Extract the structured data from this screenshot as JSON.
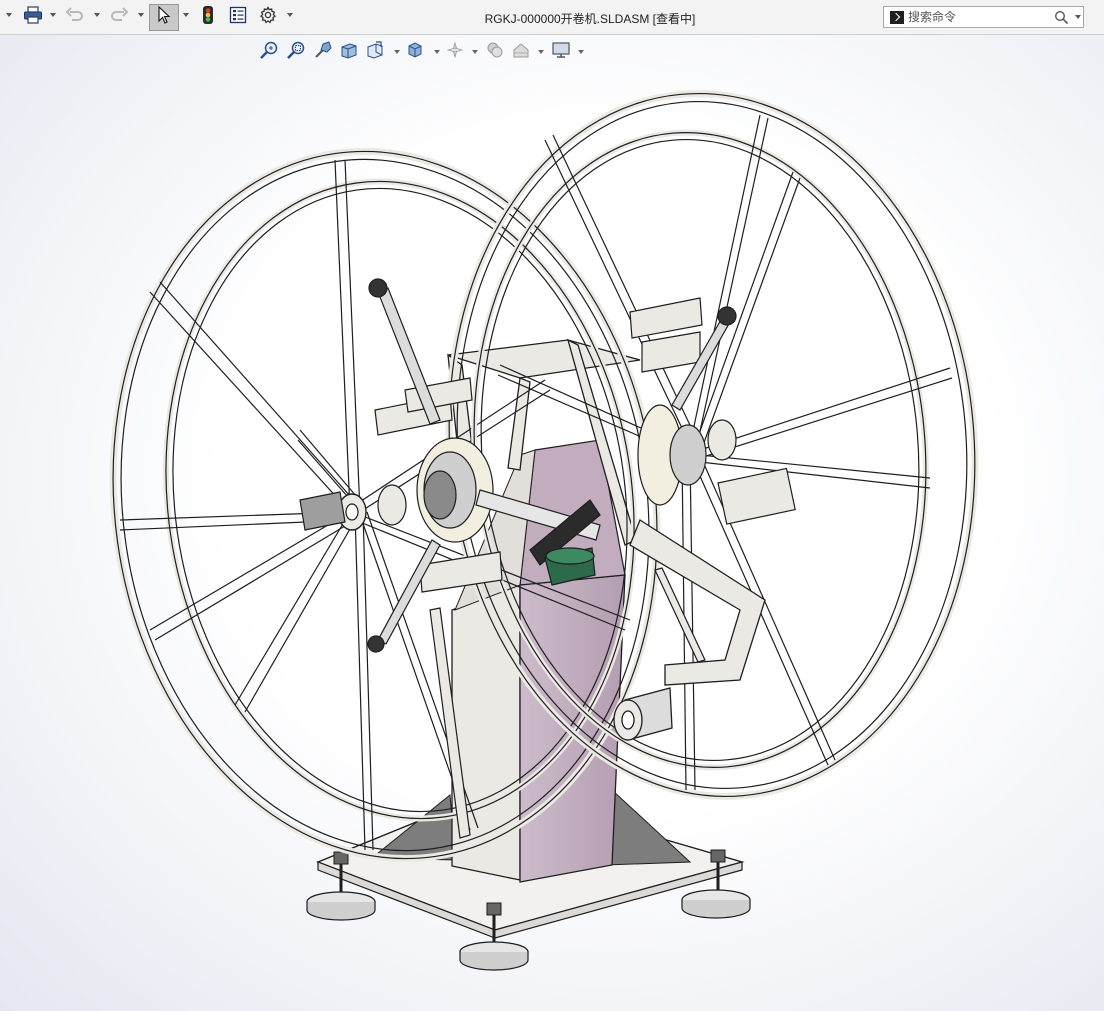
{
  "window": {
    "title": "RGKJ-000000开卷机.SLDASM [查看中]"
  },
  "toolbar": {
    "items": [
      {
        "name": "print",
        "icon": "printer-icon"
      },
      {
        "name": "undo",
        "icon": "undo-icon"
      },
      {
        "name": "redo",
        "icon": "redo-icon"
      },
      {
        "name": "select",
        "icon": "cursor-arrow-icon"
      },
      {
        "name": "rebuild",
        "icon": "traffic-light-icon"
      },
      {
        "name": "file-properties",
        "icon": "file-properties-icon"
      },
      {
        "name": "options",
        "icon": "gear-icon"
      }
    ]
  },
  "search": {
    "placeholder": "搜索命令",
    "value": ""
  },
  "heads_up_toolbar": {
    "items": [
      {
        "name": "zoom-to-fit",
        "icon": "zoom-fit-icon"
      },
      {
        "name": "zoom-to-area",
        "icon": "zoom-area-icon"
      },
      {
        "name": "previous-view",
        "icon": "previous-view-icon"
      },
      {
        "name": "section-view",
        "icon": "section-view-icon"
      },
      {
        "name": "dynamic-annotation",
        "icon": "view-orientation-icon"
      },
      {
        "name": "display-style",
        "icon": "display-style-icon"
      },
      {
        "name": "hide-show",
        "icon": "hide-show-icon"
      },
      {
        "name": "edit-appearance",
        "icon": "appearance-icon"
      },
      {
        "name": "apply-scene",
        "icon": "scene-icon"
      },
      {
        "name": "view-settings",
        "icon": "monitor-icon"
      }
    ]
  },
  "colors": {
    "frame": "#ebe9e4",
    "edge": "#1e1e1e",
    "body_purple": "#bfaabd",
    "base_plate": "#f3f1ee",
    "gusset": "#7d7d7d",
    "motor_green": "#2c6a4a"
  }
}
